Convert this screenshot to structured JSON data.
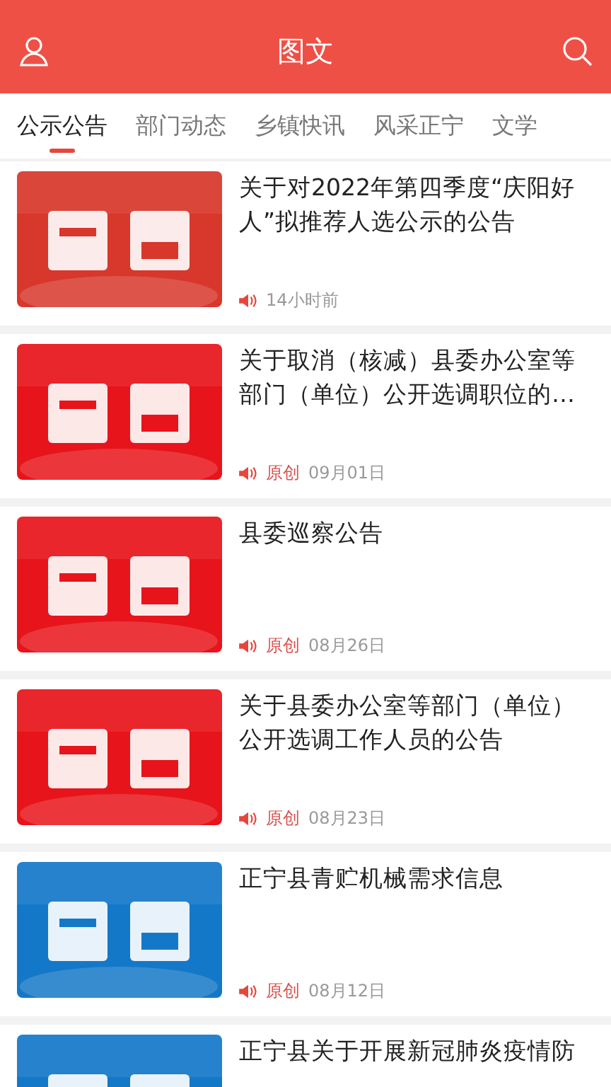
{
  "header": {
    "title": "图文"
  },
  "tabs": [
    {
      "label": "公示公告",
      "selected": true
    },
    {
      "label": "部门动态",
      "selected": false
    },
    {
      "label": "乡镇快讯",
      "selected": false
    },
    {
      "label": "风采正宁",
      "selected": false
    },
    {
      "label": "文学",
      "selected": false
    }
  ],
  "articles": [
    {
      "title": "关于对2022年第四季度“庆阳好人”拟推荐人选公示的公告",
      "original": false,
      "time": "14小时前",
      "color": "#d8372b"
    },
    {
      "title": "关于取消（核减）县委办公室等部门（单位）公开选调职位的…",
      "original": true,
      "tag": "原创",
      "time": "09月01日",
      "color": "#e8141b"
    },
    {
      "title": "县委巡察公告",
      "original": true,
      "tag": "原创",
      "time": "08月26日",
      "color": "#e8141b"
    },
    {
      "title": "关于县委办公室等部门（单位）公开选调工作人员的公告",
      "original": true,
      "tag": "原创",
      "time": "08月23日",
      "color": "#e8141b"
    },
    {
      "title": "正宁县青贮机械需求信息",
      "original": true,
      "tag": "原创",
      "time": "08月12日",
      "color": "#1478c8"
    },
    {
      "title": "正宁县关于开展新冠肺炎疫情防",
      "color": "#1478c8"
    }
  ]
}
